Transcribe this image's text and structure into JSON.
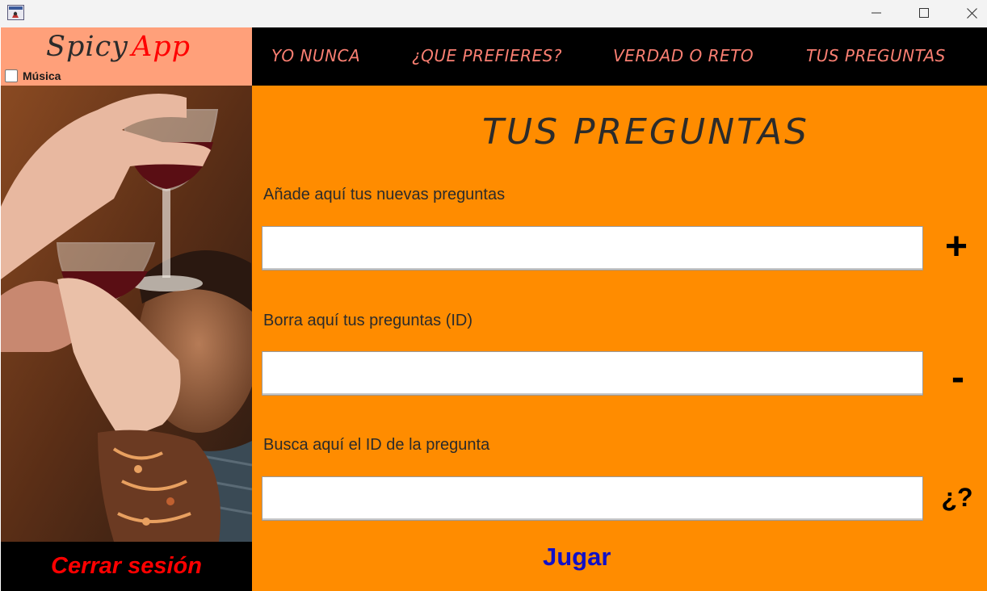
{
  "window": {
    "minimize_icon": "minimize-icon",
    "maximize_icon": "maximize-icon",
    "close_icon": "close-icon"
  },
  "brand": {
    "spicy": "Spicy",
    "app": "App",
    "accent_color": "#ff0000",
    "panel_color": "#ffa07a"
  },
  "music": {
    "label": "Música",
    "checked": false
  },
  "nav": {
    "items": [
      {
        "label": "YO NUNCA"
      },
      {
        "label": "¿QUE PREFIERES?"
      },
      {
        "label": "VERDAD O RETO"
      },
      {
        "label": "TUS PREGUNTAS"
      }
    ],
    "text_color": "#fa7f72"
  },
  "sidebar": {
    "logout_label": "Cerrar sesión"
  },
  "main": {
    "title": "TUS PREGUNTAS",
    "background": "#ff8c00",
    "add": {
      "label": "Añade aquí tus nuevas preguntas",
      "value": "",
      "action_label": "+"
    },
    "delete": {
      "label": "Borra aquí tus preguntas (ID)",
      "value": "",
      "action_label": "-"
    },
    "find": {
      "label": "Busca aquí el ID de la pregunta",
      "value": "",
      "action_label": "¿?"
    },
    "play_label": "Jugar"
  }
}
